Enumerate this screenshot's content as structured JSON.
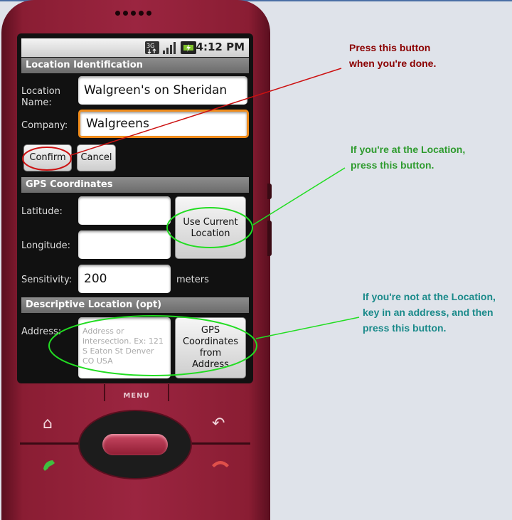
{
  "status_bar": {
    "time": "4:12 PM",
    "icons": [
      "3g-icon",
      "signal-icon",
      "battery-charging-icon"
    ]
  },
  "location": {
    "header": "Location Identification",
    "name_label": "Location Name:",
    "name_value": "Walgreen's on Sheridan",
    "company_label": "Company:",
    "company_value": "Walgreens",
    "confirm_label": "Confirm",
    "cancel_label": "Cancel"
  },
  "gps": {
    "header": "GPS Coordinates",
    "latitude_label": "Latitude:",
    "latitude_value": "",
    "longitude_label": "Longitude:",
    "longitude_value": "",
    "use_current_label": "Use Current Location",
    "sensitivity_label": "Sensitivity:",
    "sensitivity_value": "200",
    "sensitivity_unit": "meters"
  },
  "descriptive": {
    "header": "Descriptive Location (opt)",
    "address_label": "Address:",
    "address_placeholder": "Address or intersection. Ex: 121 S Eaton St Denver CO USA",
    "gps_from_address_label": "GPS Coordinates from Address"
  },
  "hardware": {
    "menu_label": "MENU",
    "icons": [
      "home-icon",
      "back-icon",
      "call-icon",
      "end-call-icon"
    ]
  },
  "annotations": {
    "confirm_note": "Press this button\nwhen you're done.",
    "current_location_note": "If you're at the Location,\npress this button.",
    "address_note": "If you're not at the Location,\nkey in an address, and then\npress this button."
  },
  "colors": {
    "confirm_note": "#8b0000",
    "current_location_note": "#2e9b2e",
    "address_note": "#1a8a8a",
    "phone_body": "#9b2540",
    "focus_border": "#f08c1c"
  }
}
